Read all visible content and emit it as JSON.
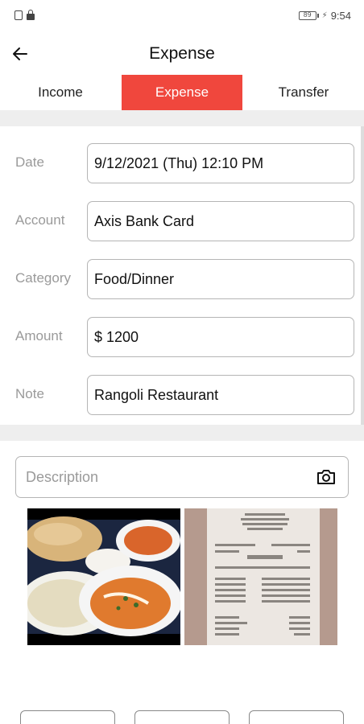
{
  "status_bar": {
    "time": "9:54",
    "battery": "89",
    "left_icons": [
      "sim-icon",
      "lock-icon"
    ]
  },
  "app_bar": {
    "title": "Expense",
    "back_icon": "arrow-left-icon"
  },
  "tabs": [
    {
      "label": "Income",
      "active": false
    },
    {
      "label": "Expense",
      "active": true
    },
    {
      "label": "Transfer",
      "active": false
    }
  ],
  "form": {
    "date": {
      "label": "Date",
      "value": "9/12/2021 (Thu)   12:10 PM"
    },
    "account": {
      "label": "Account",
      "value": "Axis Bank Card"
    },
    "category": {
      "label": "Category",
      "value": "Food/Dinner"
    },
    "amount": {
      "label": "Amount",
      "value": "$ 1200"
    },
    "note": {
      "label": "Note",
      "value": "Rangoli Restaurant"
    }
  },
  "description": {
    "placeholder": "Description",
    "icon": "camera-icon"
  },
  "attachments": [
    {
      "name": "food-photo"
    },
    {
      "name": "receipt-photo"
    }
  ],
  "colors": {
    "accent": "#f0473d",
    "label_gray": "#9a9a9a",
    "border_gray": "#b5b5b5",
    "band_gray": "#eeeeee"
  }
}
